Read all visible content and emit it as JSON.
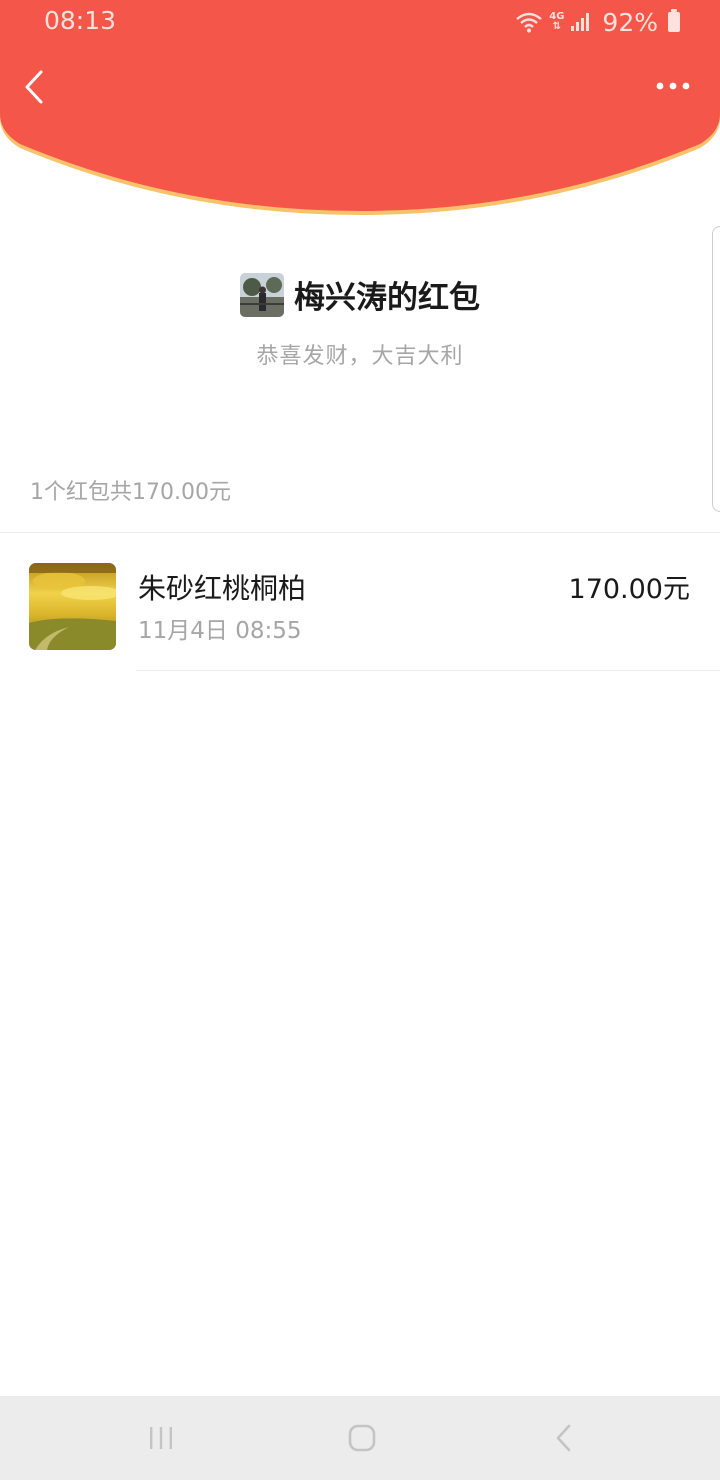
{
  "status_bar": {
    "time": "08:13",
    "network": "4G",
    "battery": "92%"
  },
  "header": {
    "color": "#f5564a",
    "border_color": "#f6c36a",
    "back_icon": "chevron-left-icon",
    "more_icon": "more-horizontal-icon"
  },
  "sender": {
    "title": "梅兴涛的红包",
    "blessing": "恭喜发财，大吉大利"
  },
  "summary": "1个红包共170.00元",
  "records": [
    {
      "name": "朱砂红桃桐柏",
      "time": "11月4日  08:55",
      "amount": "170.00元"
    }
  ],
  "nav_bar": {
    "recent_icon": "recent-apps-icon",
    "home_icon": "home-icon",
    "back_icon": "back-icon"
  }
}
